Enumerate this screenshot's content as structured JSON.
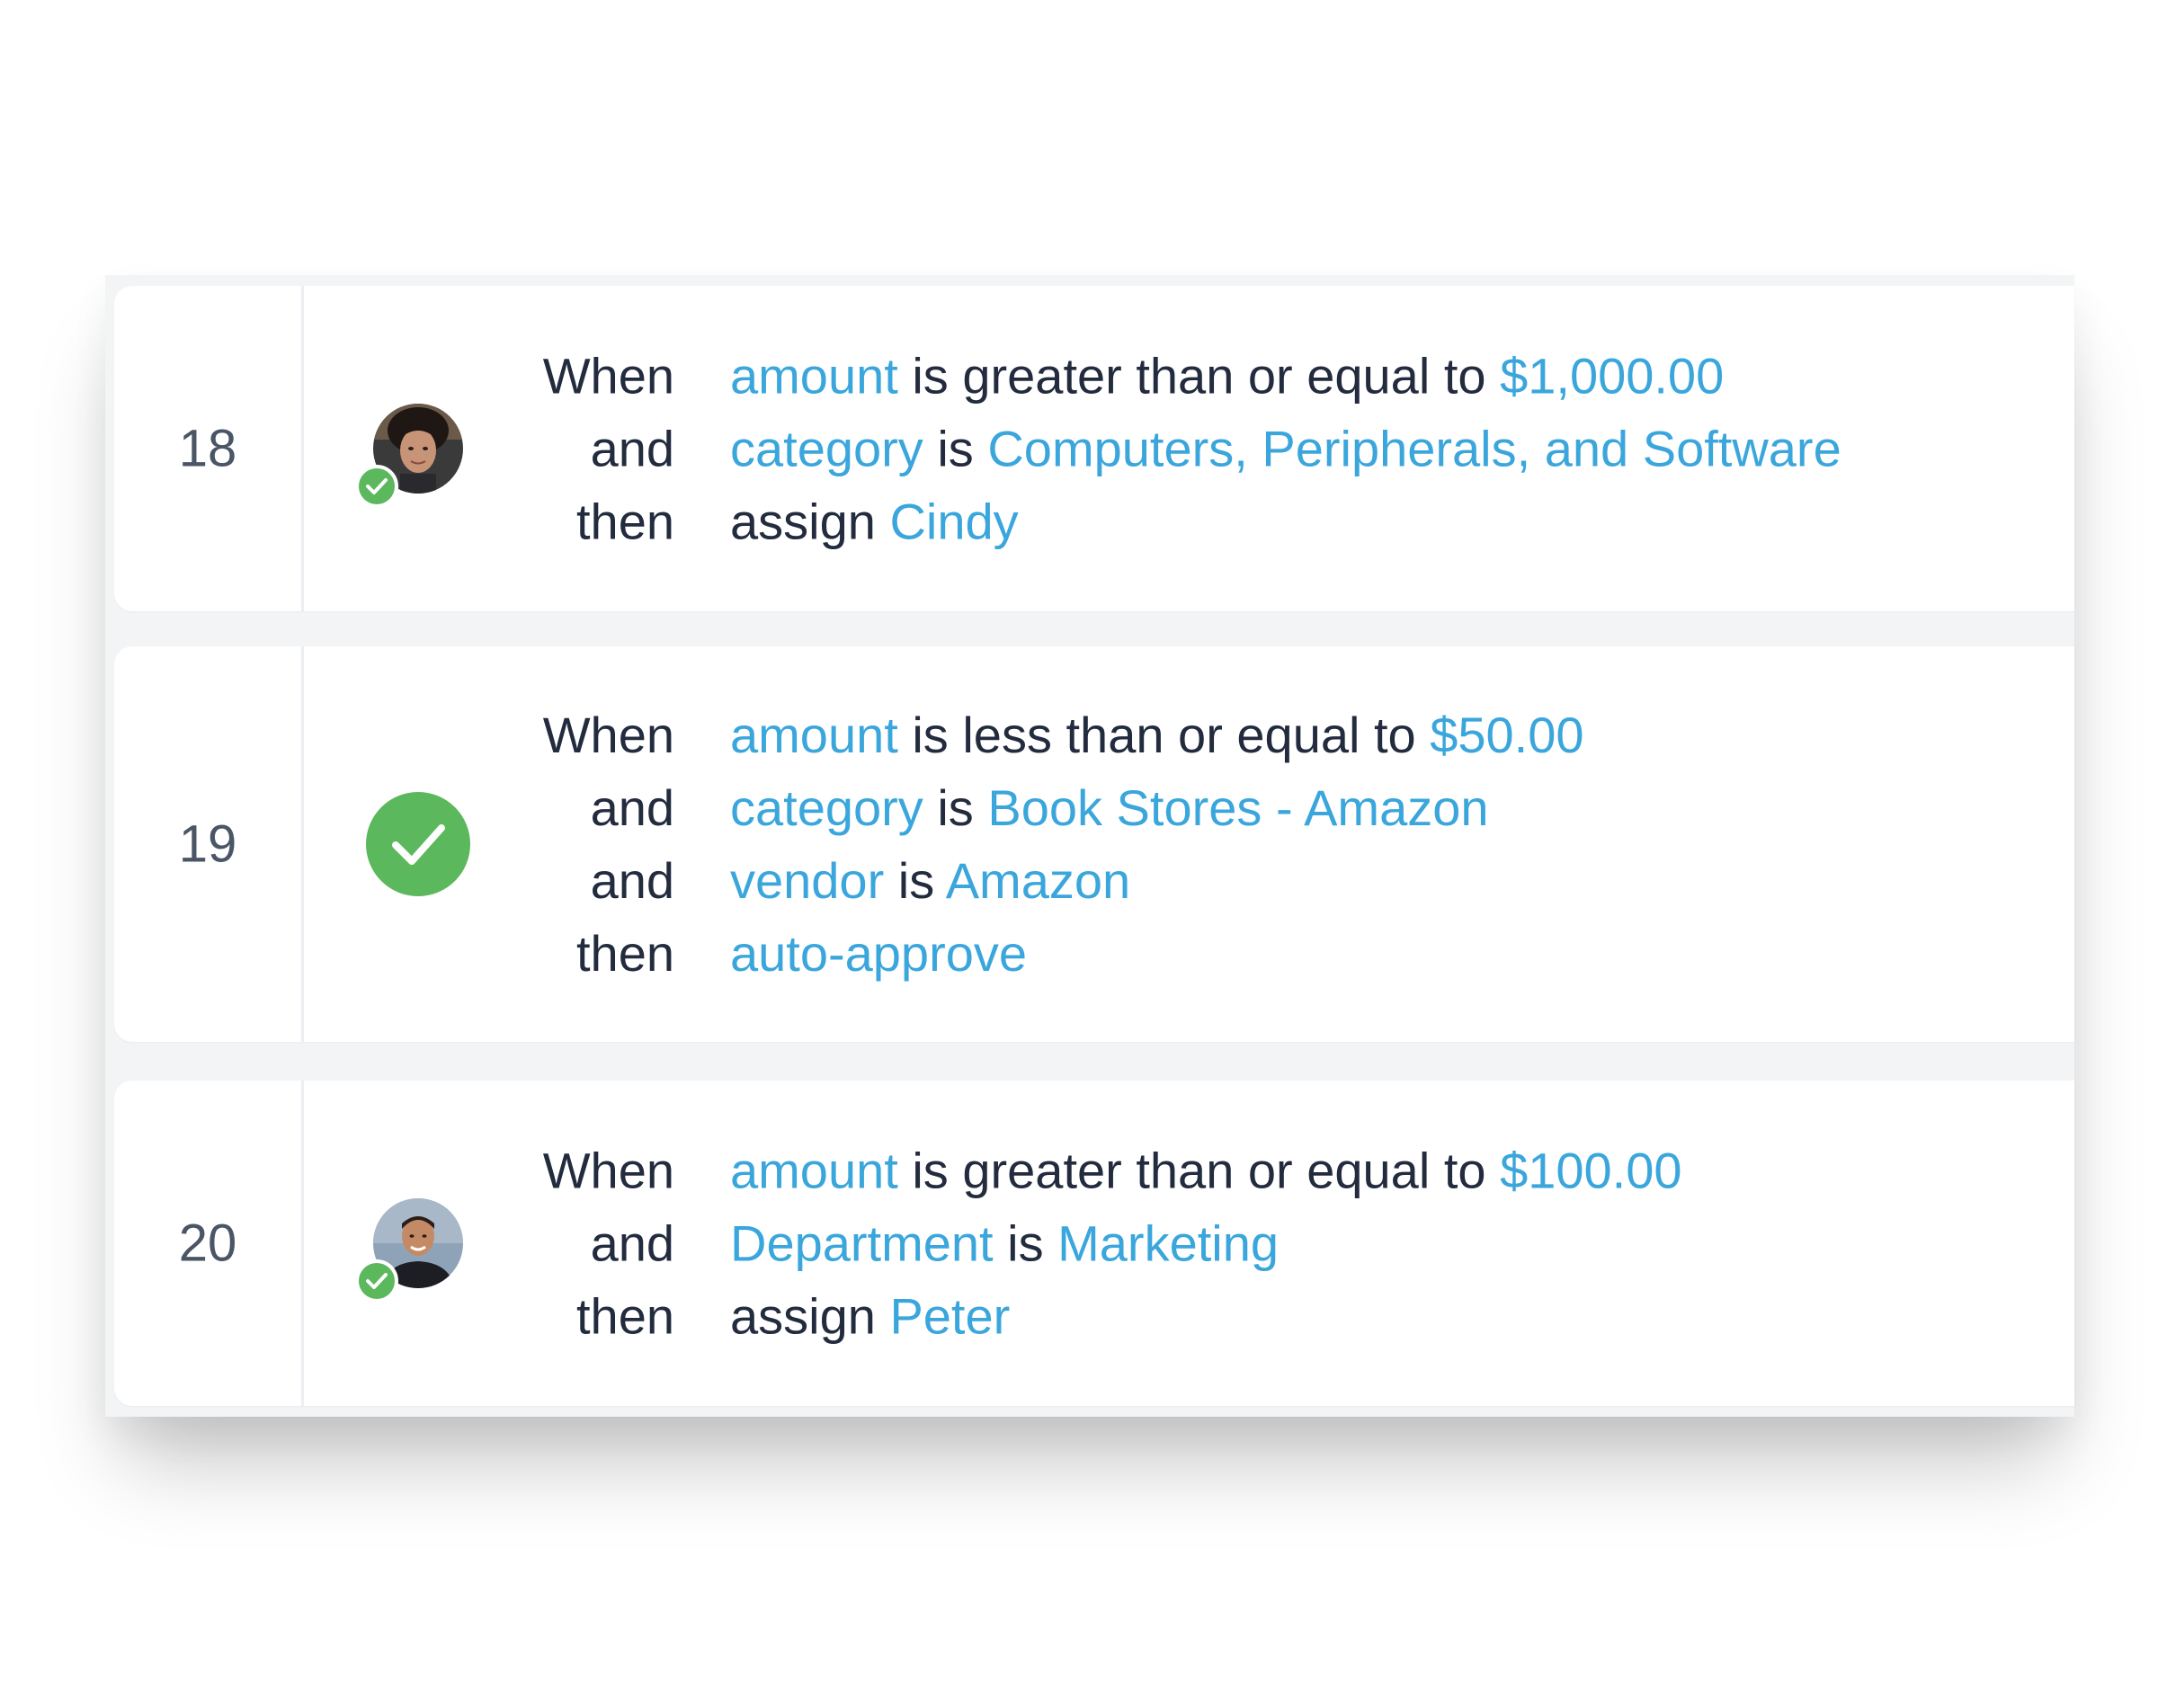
{
  "colors": {
    "highlight": "#3aa6dc",
    "text": "#232b3e",
    "number": "#4a5566",
    "check_green": "#5cb85c"
  },
  "rules": [
    {
      "number": "18",
      "icon": "avatar-with-check",
      "lines": [
        {
          "keyword": "When",
          "parts": [
            {
              "t": "amount",
              "hl": true
            },
            {
              "t": " is greater than or equal to ",
              "hl": false
            },
            {
              "t": "$1,000.00",
              "hl": true
            }
          ]
        },
        {
          "keyword": "and",
          "parts": [
            {
              "t": "category",
              "hl": true
            },
            {
              "t": " is ",
              "hl": false
            },
            {
              "t": "Computers, Peripherals, and Software",
              "hl": true
            }
          ]
        },
        {
          "keyword": "then",
          "parts": [
            {
              "t": "assign ",
              "hl": false
            },
            {
              "t": "Cindy",
              "hl": true
            }
          ]
        }
      ]
    },
    {
      "number": "19",
      "icon": "check-circle-icon",
      "lines": [
        {
          "keyword": "When",
          "parts": [
            {
              "t": "amount",
              "hl": true
            },
            {
              "t": " is less than or equal to ",
              "hl": false
            },
            {
              "t": "$50.00",
              "hl": true
            }
          ]
        },
        {
          "keyword": "and",
          "parts": [
            {
              "t": "category",
              "hl": true
            },
            {
              "t": " is ",
              "hl": false
            },
            {
              "t": "Book Stores - Amazon",
              "hl": true
            }
          ]
        },
        {
          "keyword": "and",
          "parts": [
            {
              "t": "vendor",
              "hl": true
            },
            {
              "t": " is ",
              "hl": false
            },
            {
              "t": "Amazon",
              "hl": true
            }
          ]
        },
        {
          "keyword": "then",
          "parts": [
            {
              "t": "auto-approve",
              "hl": true
            }
          ]
        }
      ]
    },
    {
      "number": "20",
      "icon": "avatar-with-check",
      "lines": [
        {
          "keyword": "When",
          "parts": [
            {
              "t": "amount",
              "hl": true
            },
            {
              "t": " is greater than or equal to ",
              "hl": false
            },
            {
              "t": "$100.00",
              "hl": true
            }
          ]
        },
        {
          "keyword": "and",
          "parts": [
            {
              "t": "Department",
              "hl": true
            },
            {
              "t": " is ",
              "hl": false
            },
            {
              "t": "Marketing",
              "hl": true
            }
          ]
        },
        {
          "keyword": "then",
          "parts": [
            {
              "t": "assign ",
              "hl": false
            },
            {
              "t": "Peter",
              "hl": true
            }
          ]
        }
      ]
    }
  ]
}
